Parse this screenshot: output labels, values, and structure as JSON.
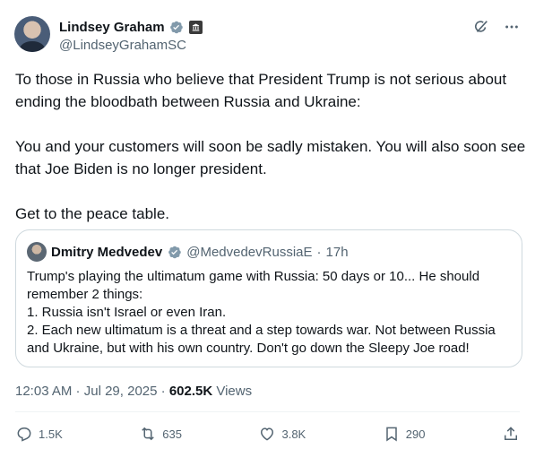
{
  "author": {
    "display_name": "Lindsey Graham",
    "handle": "@LindseyGrahamSC",
    "verified_color": "#829aab"
  },
  "tweet": {
    "paragraphs": [
      "To those in Russia who believe that President Trump is not serious about ending the bloodbath between Russia and Ukraine:",
      "You and your customers will soon be sadly mistaken. You will also soon see that Joe Biden is no longer president.",
      "Get to the peace table."
    ]
  },
  "quote": {
    "display_name": "Dmitry Medvedev",
    "handle": "@MedvedevRussiaE",
    "dot": "·",
    "time": "17h",
    "verified_color": "#829aab",
    "body": "Trump's playing the ultimatum game with Russia: 50 days or 10... He should remember 2 things:\n1. Russia isn't Israel or even Iran.\n2. Each new ultimatum is a threat and a step towards war. Not between Russia and Ukraine, but with his own country. Don't go down the Sleepy Joe road!"
  },
  "meta": {
    "time": "12:03 AM",
    "sep1": " · ",
    "date": "Jul 29, 2025",
    "sep2": " · ",
    "views_count": "602.5K",
    "views_label": " Views"
  },
  "actions": {
    "replies": "1.5K",
    "reposts": "635",
    "likes": "3.8K",
    "bookmarks": "290"
  },
  "icons": [
    "grok-icon",
    "more-icon",
    "reply-icon",
    "repost-icon",
    "like-icon",
    "bookmark-icon",
    "share-icon"
  ]
}
